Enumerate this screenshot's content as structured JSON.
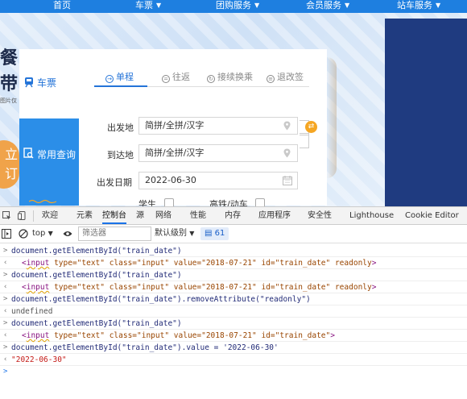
{
  "nav": {
    "items": [
      {
        "label": "首页",
        "chevron": false
      },
      {
        "label": "车票",
        "chevron": true
      },
      {
        "label": "团购服务",
        "chevron": true
      },
      {
        "label": "会员服务",
        "chevron": true
      },
      {
        "label": "站车服务",
        "chevron": true
      }
    ]
  },
  "hero": {
    "art_char1": "餐",
    "art_char2": "带",
    "art_small": "图片仅",
    "orange_text": "立\n订"
  },
  "sidebar": {
    "ticket_label": "车票",
    "query_label": "常用查询"
  },
  "booking": {
    "tabs": [
      "单程",
      "往返",
      "接续换乘",
      "退改签"
    ],
    "from_label": "出发地",
    "from_placeholder": "简拼/全拼/汉字",
    "to_label": "到达地",
    "to_placeholder": "简拼/全拼/汉字",
    "date_label": "出发日期",
    "date_value": "2022-06-30",
    "student_label": "学生",
    "highspeed_label": "高铁/动车",
    "swap_glyph": "⇄"
  },
  "devtools": {
    "tabs": [
      "欢迎",
      "元素",
      "控制台",
      "源",
      "网络",
      "性能",
      "内存",
      "应用程序",
      "安全性",
      "Lighthouse",
      "Cookie Editor"
    ],
    "active_tab": "控制台",
    "context": "top",
    "filter_placeholder": "筛选器",
    "levels": "默认级别",
    "issues_count": "61"
  },
  "console": {
    "lines": [
      {
        "kind": "in",
        "text": "document.getElementById(\"train_date\")"
      },
      {
        "kind": "el",
        "tag": "input",
        "attrs": "type=\"text\" class=\"input\" value=\"2018-07-21\" id=\"train_date\" readonly"
      },
      {
        "kind": "in",
        "text": "document.getElementById(\"train_date\")"
      },
      {
        "kind": "el",
        "tag": "input",
        "attrs": "type=\"text\" class=\"input\" value=\"2018-07-21\" id=\"train_date\" readonly"
      },
      {
        "kind": "in",
        "text": "document.getElementById(\"train_date\").removeAttribute(\"readonly\")"
      },
      {
        "kind": "out",
        "text": "undefined"
      },
      {
        "kind": "in",
        "text": "document.getElementById(\"train_date\")"
      },
      {
        "kind": "el",
        "tag": "input",
        "attrs": "type=\"text\" class=\"input\" value=\"2018-07-21\" id=\"train_date\""
      },
      {
        "kind": "in",
        "text": "document.getElementById(\"train_date\").value = '2022-06-30'"
      },
      {
        "kind": "string",
        "text": "\"2022-06-30\""
      }
    ]
  },
  "colors": {
    "nav_bg": "#1e7fe0",
    "accent": "#2474d8",
    "swap": "#f5a623",
    "dark_panel": "#1f3b80"
  }
}
